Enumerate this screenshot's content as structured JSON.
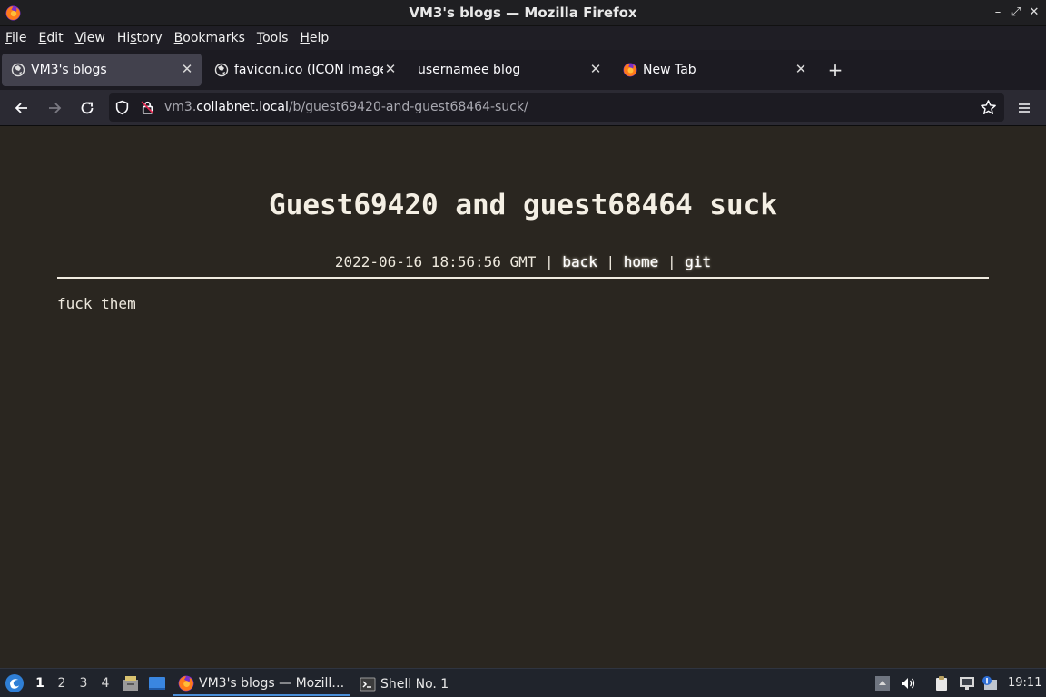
{
  "window": {
    "title": "VM3's blogs — Mozilla Firefox"
  },
  "menubar": {
    "items": [
      {
        "pre": "",
        "key": "F",
        "post": "ile"
      },
      {
        "pre": "",
        "key": "E",
        "post": "dit"
      },
      {
        "pre": "",
        "key": "V",
        "post": "iew"
      },
      {
        "pre": "Hi",
        "key": "s",
        "post": "tory"
      },
      {
        "pre": "",
        "key": "B",
        "post": "ookmarks"
      },
      {
        "pre": "",
        "key": "T",
        "post": "ools"
      },
      {
        "pre": "",
        "key": "H",
        "post": "elp"
      }
    ]
  },
  "tabs": [
    {
      "label": "VM3's blogs",
      "icon": "globe-icon",
      "active": true
    },
    {
      "label": "favicon.ico (ICON Image,",
      "icon": "globe-icon",
      "active": false
    },
    {
      "label": "usernamee blog",
      "icon": "",
      "active": false
    },
    {
      "label": "New Tab",
      "icon": "firefox-icon",
      "active": false
    }
  ],
  "urlbar": {
    "prefix": "vm3.",
    "host": "collabnet.local",
    "path": "/b/guest69420-and-guest68464-suck/"
  },
  "post": {
    "title": "Guest69420 and guest68464 suck",
    "timestamp": "2022-06-16 18:56:56 GMT",
    "separator": "|",
    "links": {
      "back": "back",
      "home": "home",
      "git": "git"
    },
    "body": "fuck them"
  },
  "taskbar": {
    "workspaces": [
      "1",
      "2",
      "3",
      "4"
    ],
    "active_workspace": "1",
    "tasks": [
      {
        "label": "VM3's blogs — Mozill…",
        "icon": "firefox-icon"
      },
      {
        "label": "Shell No. 1",
        "icon": "terminal-icon"
      }
    ],
    "clock": "19:11"
  },
  "colors": {
    "page_bg": "#2a2620",
    "accent": "#4a8fd8"
  }
}
